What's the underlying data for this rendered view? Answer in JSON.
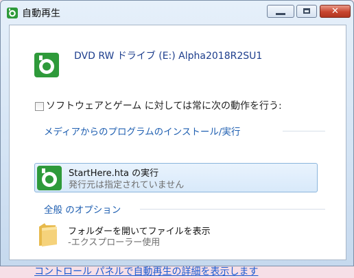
{
  "window": {
    "title": "自動再生"
  },
  "drive": {
    "title": "DVD RW ドライブ (E:) Alpha2018R2SU1"
  },
  "checkbox": {
    "label": "ソフトウェアとゲーム に対しては常に次の動作を行う:"
  },
  "sections": {
    "install": "メディアからのプログラムのインストール/実行",
    "general": "全般 のオプション"
  },
  "options": {
    "run": {
      "title": "StartHere.hta の実行",
      "subtitle": "発行元は指定されていません"
    },
    "open_folder": {
      "title": "フォルダーを開いてファイルを表示",
      "subtitle": "-エクスプローラー使用"
    }
  },
  "footer": {
    "link": "コントロール パネルで自動再生の詳細を表示します"
  },
  "colors": {
    "accent_green": "#2e9a3a",
    "link_blue": "#1a5ad1",
    "section_blue": "#1f5fb1"
  },
  "icons": {
    "app": "autoplay-icon",
    "option_run": "autoplay-icon",
    "option_folder": "folder-icon"
  }
}
